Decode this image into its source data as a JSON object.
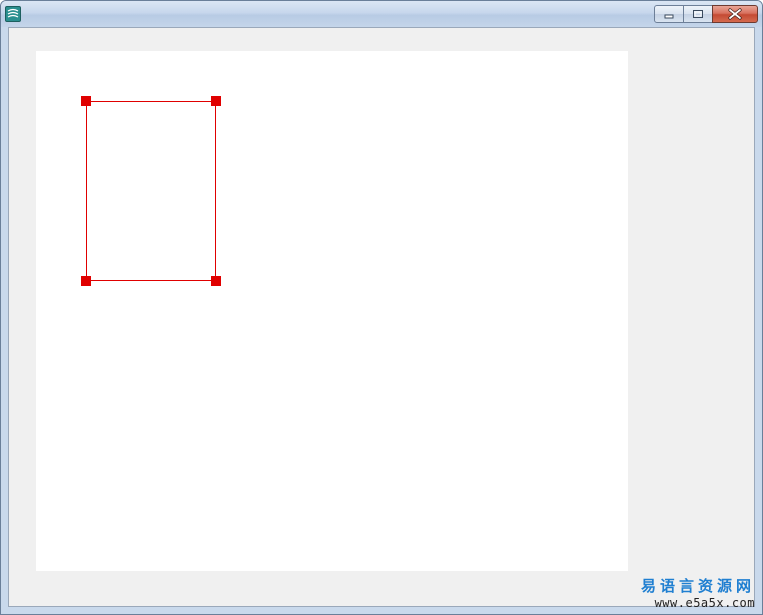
{
  "window": {
    "icons": {
      "app": "app-icon",
      "minimize": "minimize-icon",
      "maximize": "maximize-icon",
      "close": "close-icon"
    },
    "colors": {
      "titlebar": "#c7d7ec",
      "client_background": "#f0f0f0",
      "canvas_background": "#ffffff",
      "close_button": "#c44a33"
    }
  },
  "canvas": {
    "shape": {
      "type": "rectangle",
      "stroke_color": "#e00000",
      "handle_color": "#e00000",
      "handles": [
        "top-left",
        "top-right",
        "bottom-left",
        "bottom-right"
      ]
    }
  },
  "watermark": {
    "chinese": "易语言资源网",
    "url": "www.e5a5x.com",
    "chinese_color": "#1f7fd1"
  }
}
